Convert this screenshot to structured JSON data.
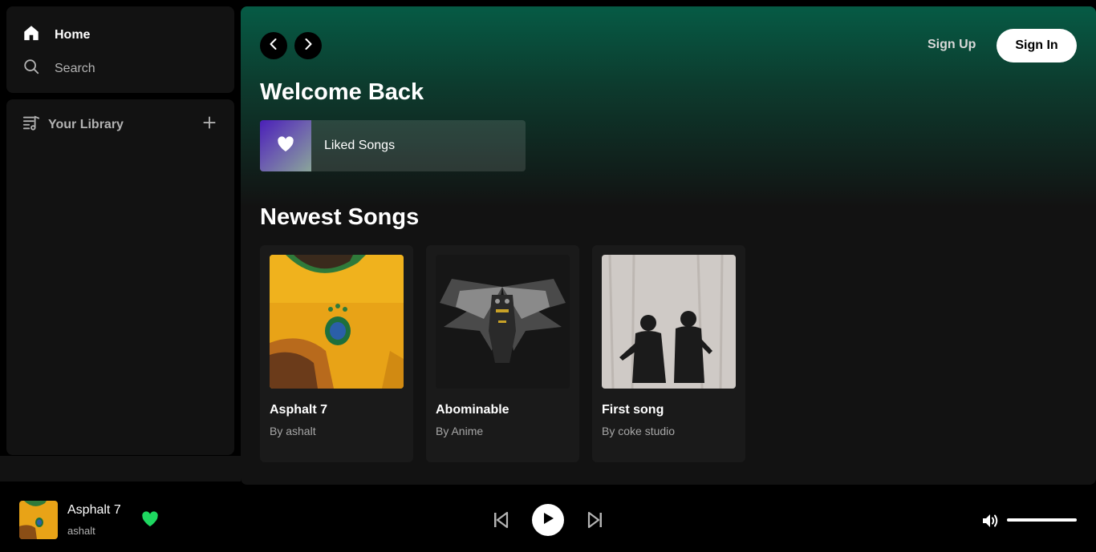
{
  "sidebar": {
    "nav": {
      "home_label": "Home",
      "search_label": "Search"
    },
    "library": {
      "label": "Your Library"
    }
  },
  "header": {
    "signup_label": "Sign Up",
    "signin_label": "Sign In"
  },
  "main": {
    "welcome_heading": "Welcome Back",
    "liked_songs_label": "Liked Songs",
    "newest_heading": "Newest Songs",
    "songs": [
      {
        "title": "Asphalt 7",
        "subtitle": "By ashalt",
        "art": "yellow-jersey-art"
      },
      {
        "title": "Abominable",
        "subtitle": "By Anime",
        "art": "mech-owl-art"
      },
      {
        "title": "First song",
        "subtitle": "By coke studio",
        "art": "two-men-art"
      }
    ]
  },
  "player": {
    "track_title": "Asphalt 7",
    "track_artist": "ashalt",
    "liked": true,
    "volume": 1.0
  },
  "colors": {
    "accent_green": "#1ed760",
    "main_gradient_top": "#065b45",
    "panel_bg": "#121212"
  },
  "icons": {
    "home": "home-icon",
    "search": "search-icon",
    "library": "library-icon",
    "add": "plus-icon",
    "back": "chevron-left-icon",
    "forward": "chevron-right-icon",
    "liked": "heart-icon",
    "prev": "skip-back-icon",
    "play": "play-icon",
    "next": "skip-forward-icon",
    "volume": "volume-icon"
  }
}
